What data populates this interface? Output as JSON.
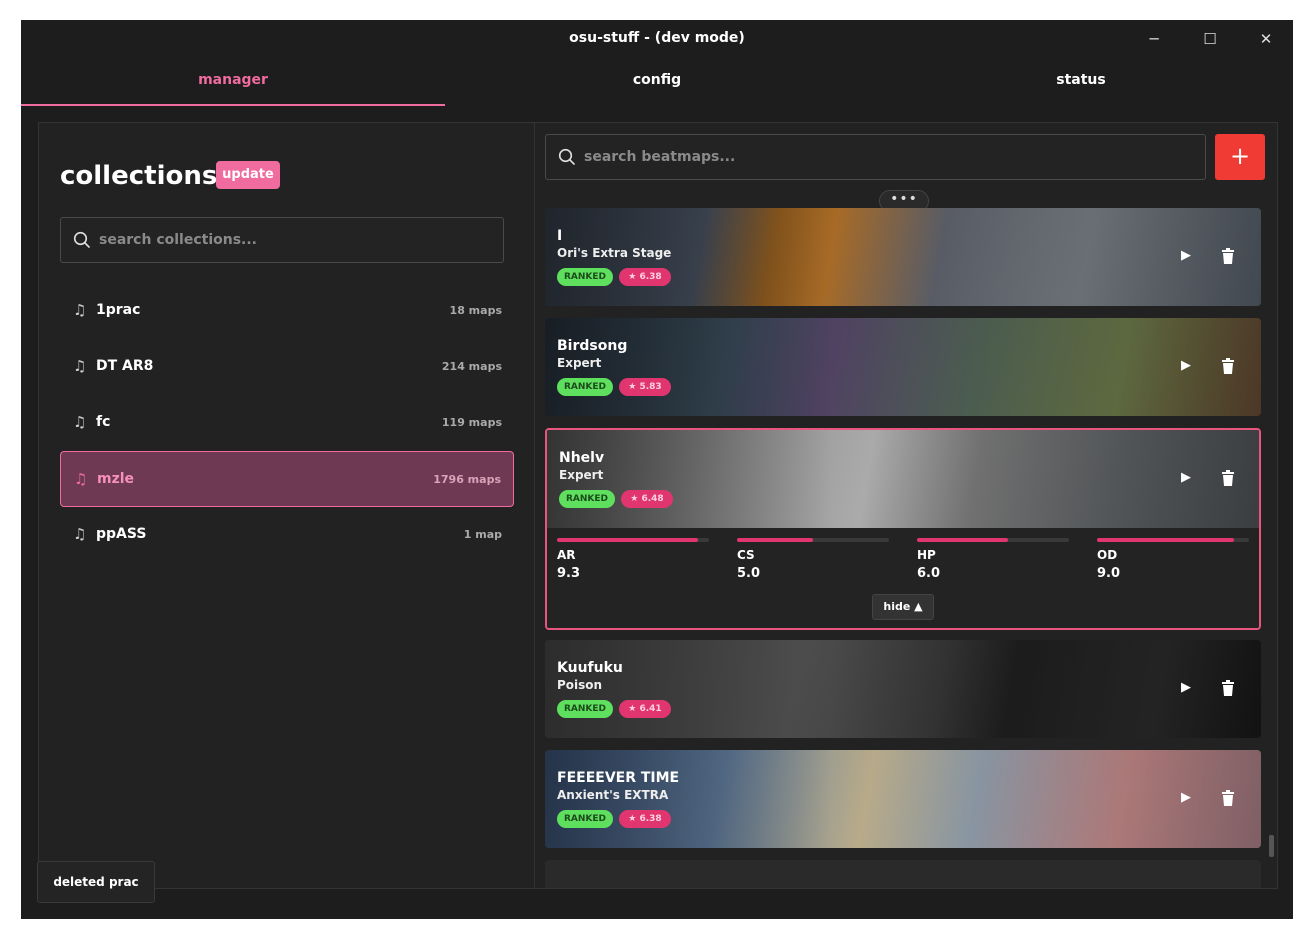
{
  "window": {
    "title": "osu-stuff - (dev mode)",
    "minimize": "─",
    "maximize": "☐",
    "close": "✕"
  },
  "tabs": [
    {
      "label": "manager"
    },
    {
      "label": "config"
    },
    {
      "label": "status"
    }
  ],
  "collections": {
    "title": "collections",
    "update_label": "update",
    "search_placeholder": "search collections...",
    "items": [
      {
        "name": "1prac",
        "count": "18 maps"
      },
      {
        "name": "DT AR8",
        "count": "214 maps"
      },
      {
        "name": "fc",
        "count": "119 maps"
      },
      {
        "name": "mzle",
        "count": "1796 maps"
      },
      {
        "name": "ppASS",
        "count": "1 map"
      }
    ]
  },
  "beatmaps": {
    "search_placeholder": "search beatmaps...",
    "add_label": "+",
    "more_label": "•••",
    "items": [
      {
        "title": "I",
        "difficulty": "Ori's Extra Stage",
        "status": "RANKED",
        "stars": "★ 6.38"
      },
      {
        "title": "Birdsong",
        "difficulty": "Expert",
        "status": "RANKED",
        "stars": "★ 5.83"
      },
      {
        "title": "Nhelv",
        "difficulty": "Expert",
        "status": "RANKED",
        "stars": "★ 6.48"
      },
      {
        "title": "Kuufuku",
        "difficulty": "Poison",
        "status": "RANKED",
        "stars": "★ 6.41"
      },
      {
        "title": "FEEEEVER TIME",
        "difficulty": "Anxient's EXTRA",
        "status": "RANKED",
        "stars": "★ 6.38"
      }
    ],
    "expanded_stats": [
      {
        "label": "AR",
        "value": "9.3",
        "fraction": 0.93
      },
      {
        "label": "CS",
        "value": "5.0",
        "fraction": 0.5
      },
      {
        "label": "HP",
        "value": "6.0",
        "fraction": 0.6
      },
      {
        "label": "OD",
        "value": "9.0",
        "fraction": 0.9
      }
    ],
    "hide_label": "hide ▲"
  },
  "toast": {
    "message": "deleted prac"
  },
  "colors": {
    "accent": "#f06b9e",
    "ranked": "#5ee05e",
    "star": "#e0356e",
    "add": "#ef3b33",
    "background": "#1d1d1d"
  }
}
